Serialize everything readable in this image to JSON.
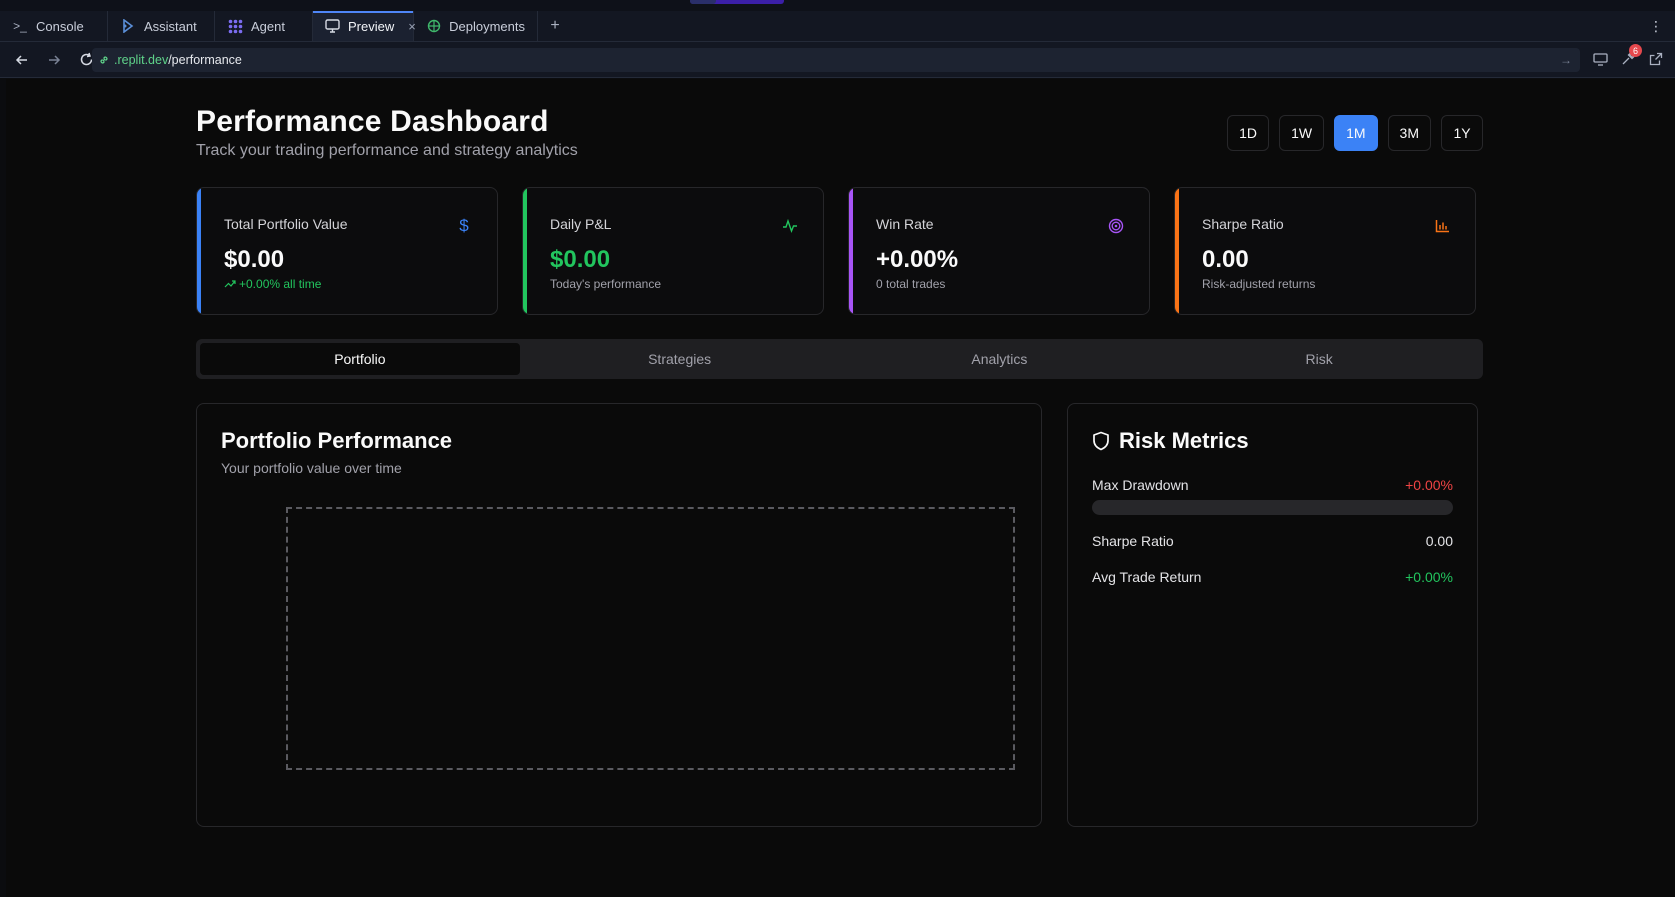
{
  "workspace": {
    "tabs": [
      {
        "label": "Console",
        "icon": "terminal-icon"
      },
      {
        "label": "Assistant",
        "icon": "assistant-icon"
      },
      {
        "label": "Agent",
        "icon": "agent-icon"
      },
      {
        "label": "Preview",
        "icon": "monitor-icon",
        "active": true,
        "close": "×"
      },
      {
        "label": "Deployments",
        "icon": "deployments-icon"
      }
    ],
    "add_tab": "+",
    "menu": "⋮",
    "notification_count": "6"
  },
  "browser": {
    "host": ".replit.dev",
    "path": "/performance"
  },
  "dashboard": {
    "title": "Performance Dashboard",
    "subtitle": "Track your trading performance and strategy analytics",
    "ranges": [
      "1D",
      "1W",
      "1M",
      "3M",
      "1Y"
    ],
    "active_range": "1M",
    "kpis": [
      {
        "label": "Total Portfolio Value",
        "value": "$0.00",
        "sub": "+0.00% all time",
        "accent": "#3b82f6",
        "icon": "dollar-icon"
      },
      {
        "label": "Daily P&L",
        "value": "$0.00",
        "sub": "Today's performance",
        "accent": "#22c55e",
        "icon": "activity-icon"
      },
      {
        "label": "Win Rate",
        "value": "+0.00%",
        "sub": "0 total trades",
        "accent": "#a855f7",
        "icon": "target-icon"
      },
      {
        "label": "Sharpe Ratio",
        "value": "0.00",
        "sub": "Risk-adjusted returns",
        "accent": "#f97316",
        "icon": "bar-chart-icon"
      }
    ],
    "tabs": [
      "Portfolio",
      "Strategies",
      "Analytics",
      "Risk"
    ],
    "active_tab": "Portfolio",
    "portfolio_card": {
      "title": "Portfolio Performance",
      "description": "Your portfolio value over time"
    },
    "risk_card": {
      "title": "Risk Metrics",
      "icon": "shield-icon",
      "rows": [
        {
          "label": "Max Drawdown",
          "value": "+0.00%",
          "color": "#ef4444",
          "progress": 0
        },
        {
          "label": "Sharpe Ratio",
          "value": "0.00",
          "color": "#e4e4e7"
        },
        {
          "label": "Avg Trade Return",
          "value": "+0.00%",
          "color": "#22c55e"
        }
      ]
    }
  },
  "colors": {
    "accent_blue": "#3b82f6",
    "positive": "#22c55e",
    "negative": "#ef4444",
    "background": "#0a0a0a"
  }
}
